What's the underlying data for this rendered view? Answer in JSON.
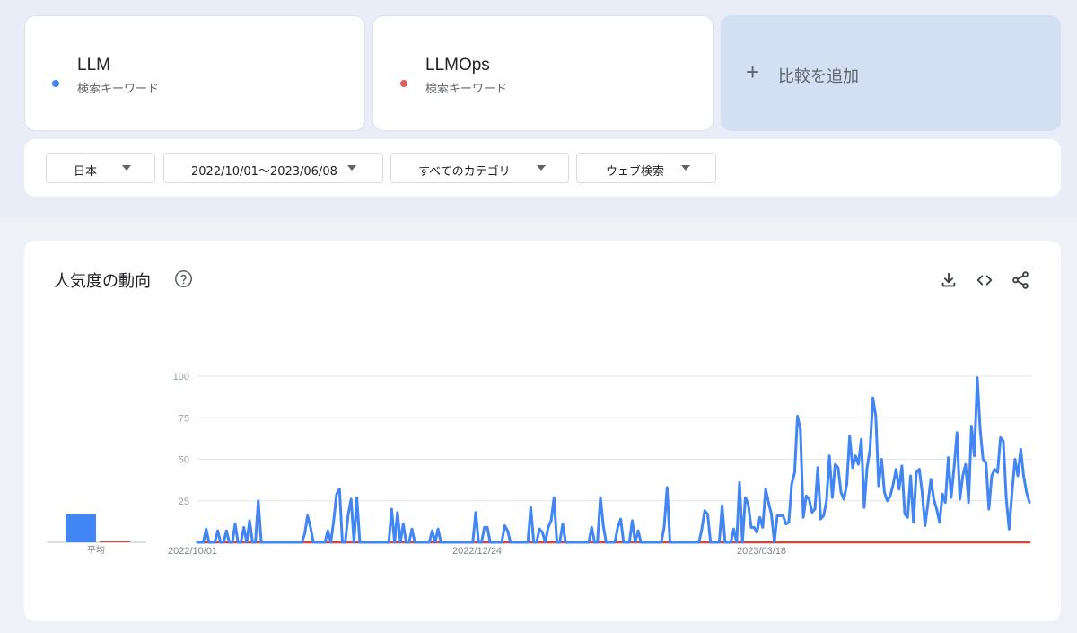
{
  "terms": [
    {
      "label": "LLM",
      "sub": "検索キーワード",
      "color": "#4285f4"
    },
    {
      "label": "LLMOps",
      "sub": "検索キーワード",
      "color": "#db4437"
    }
  ],
  "add_compare": {
    "icon": "plus-icon",
    "label": "比較を追加"
  },
  "filters": [
    {
      "label": "日本"
    },
    {
      "label": "2022/10/01〜2023/06/08"
    },
    {
      "label": "すべてのカテゴリ"
    },
    {
      "label": "ウェブ検索"
    }
  ],
  "panel": {
    "title": "人気度の動向",
    "icons": [
      "help-icon",
      "download-icon",
      "embed-code-icon",
      "share-icon"
    ]
  },
  "chart_data": {
    "type": "line",
    "y_ticks": [
      "100",
      "75",
      "50",
      "25"
    ],
    "ylim": [
      0,
      100
    ],
    "x_tick_labels": [
      "2022/10/01",
      "2022/12/24",
      "2023/03/18"
    ],
    "average_label": "平均",
    "average": {
      "LLM": 17,
      "LLMOps": 0
    },
    "series": [
      {
        "name": "LLM",
        "color": "#4285f4",
        "values": [
          0,
          0,
          0,
          8,
          0,
          0,
          0,
          7,
          0,
          0,
          7,
          0,
          0,
          11,
          0,
          0,
          9,
          0,
          13,
          0,
          0,
          25,
          0,
          0,
          0,
          0,
          0,
          0,
          0,
          0,
          0,
          0,
          0,
          0,
          0,
          0,
          0,
          5,
          16,
          9,
          0,
          0,
          0,
          0,
          0,
          7,
          0,
          13,
          29,
          32,
          0,
          0,
          17,
          26,
          0,
          27,
          0,
          0,
          0,
          0,
          0,
          0,
          0,
          0,
          0,
          0,
          0,
          20,
          0,
          18,
          0,
          11,
          0,
          0,
          8,
          0,
          0,
          0,
          0,
          0,
          0,
          7,
          0,
          8,
          0,
          0,
          0,
          0,
          0,
          0,
          0,
          0,
          0,
          0,
          0,
          0,
          18,
          0,
          0,
          9,
          9,
          0,
          0,
          0,
          0,
          0,
          10,
          7,
          0,
          0,
          0,
          0,
          0,
          0,
          0,
          21,
          0,
          0,
          8,
          6,
          0,
          9,
          13,
          27,
          0,
          0,
          11,
          0,
          0,
          0,
          0,
          0,
          0,
          0,
          0,
          0,
          9,
          0,
          0,
          27,
          10,
          0,
          0,
          0,
          0,
          9,
          14,
          0,
          0,
          0,
          13,
          0,
          7,
          0,
          0,
          0,
          0,
          0,
          0,
          0,
          0,
          9,
          33,
          0,
          0,
          0,
          0,
          0,
          0,
          0,
          0,
          0,
          0,
          0,
          8,
          19,
          17,
          0,
          0,
          0,
          0,
          22,
          0,
          0,
          0,
          8,
          0,
          36,
          0,
          27,
          23,
          9,
          9,
          6,
          15,
          9,
          32,
          24,
          17,
          0,
          16,
          16,
          16,
          11,
          12,
          35,
          42,
          76,
          68,
          15,
          28,
          26,
          18,
          20,
          45,
          14,
          16,
          25,
          52,
          27,
          47,
          45,
          30,
          26,
          35,
          64,
          45,
          52,
          47,
          62,
          21,
          45,
          56,
          87,
          76,
          34,
          50,
          30,
          25,
          28,
          35,
          44,
          32,
          46,
          17,
          15,
          40,
          12,
          42,
          44,
          30,
          10,
          24,
          38,
          26,
          20,
          12,
          29,
          24,
          51,
          27,
          45,
          66,
          26,
          40,
          47,
          24,
          70,
          52,
          99,
          68,
          50,
          48,
          20,
          40,
          44,
          42,
          63,
          61,
          26,
          8,
          30,
          50,
          40,
          56,
          40,
          30,
          24
        ]
      },
      {
        "name": "LLMOps",
        "color": "#db4437",
        "values": [
          0,
          0,
          0,
          0,
          0,
          0,
          0,
          0,
          0,
          0,
          0,
          0,
          0,
          0,
          0,
          0,
          0,
          0,
          0,
          0,
          0,
          0,
          0,
          0,
          0,
          0,
          0,
          0,
          0,
          0,
          0,
          0,
          0,
          0,
          0,
          0,
          0,
          0,
          0,
          0,
          0,
          0,
          0,
          0,
          0,
          0,
          0,
          0,
          0,
          0,
          0,
          0,
          0,
          0,
          0,
          0,
          0,
          0,
          0,
          0,
          0,
          0,
          0,
          0,
          0,
          0,
          0,
          0,
          0,
          0,
          0,
          0,
          0,
          0,
          0,
          0,
          0,
          0,
          0,
          0,
          0,
          0,
          0,
          0,
          0,
          0,
          0,
          0,
          0,
          0,
          0,
          0,
          0,
          0,
          0,
          0,
          0,
          0,
          0,
          0,
          0,
          0,
          0,
          0,
          0,
          0,
          0,
          0,
          0,
          0,
          0,
          0,
          0,
          0,
          0,
          0,
          0,
          0,
          0,
          0,
          0,
          0,
          0,
          0,
          0,
          0,
          0,
          0,
          0,
          0,
          0,
          0,
          0,
          0,
          0,
          0,
          0,
          0,
          0,
          0,
          0,
          0,
          0,
          0,
          0,
          0,
          0,
          0,
          0,
          0,
          0,
          0,
          0,
          0,
          0,
          0,
          0,
          0,
          0,
          0,
          0,
          0,
          0,
          0,
          0,
          0,
          0,
          0,
          0,
          0,
          0,
          0,
          0,
          0,
          0,
          0,
          0,
          0,
          0,
          0,
          0,
          0,
          0,
          0,
          0,
          0,
          0,
          0,
          0,
          0,
          0,
          0,
          0,
          0,
          0,
          0,
          0,
          0,
          0,
          0,
          0,
          0,
          0,
          0,
          0,
          0,
          0,
          0,
          0,
          0,
          0,
          0,
          0,
          0,
          0,
          0,
          0,
          0,
          0,
          0,
          0,
          0,
          0,
          0,
          0,
          0,
          0,
          0,
          0,
          0,
          0,
          0,
          0,
          0,
          0,
          0,
          0,
          0,
          0,
          0,
          0,
          0,
          0,
          0,
          0,
          0,
          0,
          0,
          0,
          0,
          0,
          0,
          0,
          0,
          0,
          0,
          0,
          0,
          0,
          0,
          0,
          0,
          0,
          0,
          0,
          0,
          0,
          0,
          0,
          0,
          0,
          0,
          0,
          0,
          0,
          0,
          0,
          0,
          0,
          0,
          0,
          0,
          0,
          0,
          0,
          0,
          0,
          0,
          0,
          0,
          0,
          0,
          0,
          0
        ]
      }
    ]
  }
}
